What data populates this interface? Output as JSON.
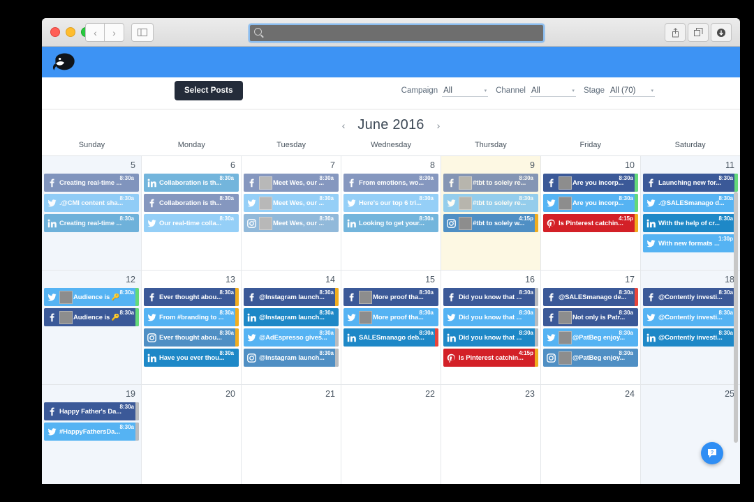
{
  "browser": {
    "search_placeholder": "",
    "search_value": "",
    "back_icon": "‹",
    "forward_icon": "›",
    "sidebar_icon": "sidebar",
    "share_icon": "share",
    "tabs_icon": "tabs",
    "downloads_icon": "downloads"
  },
  "appbar": {
    "logo_name": "whale-logo"
  },
  "toolbar": {
    "select_posts_label": "Select Posts",
    "filters": [
      {
        "label": "Campaign",
        "value": "All",
        "caret": "▾"
      },
      {
        "label": "Channel",
        "value": "All",
        "caret": "▾"
      },
      {
        "label": "Stage",
        "value": "All (70)",
        "caret": "▾"
      }
    ]
  },
  "calendar": {
    "month_title": "June 2016",
    "prev_arrow": "‹",
    "next_arrow": "›",
    "day_names": [
      "Sunday",
      "Monday",
      "Tuesday",
      "Wednesday",
      "Thursday",
      "Friday",
      "Saturday"
    ],
    "weeks": [
      {
        "days": [
          {
            "num": "5",
            "weekend": true,
            "today": false,
            "posts": [
              {
                "network": "facebook",
                "text": "Creating real-time ...",
                "time": "8:30a",
                "thumb": false,
                "stage": "",
                "dim": true
              },
              {
                "network": "twitter",
                "text": ".@CMI content sha...",
                "time": "8:30a",
                "thumb": false,
                "stage": "",
                "dim": true
              },
              {
                "network": "linkedin",
                "text": "Creating real-time ...",
                "time": "8:30a",
                "thumb": false,
                "stage": "",
                "dim": true
              }
            ]
          },
          {
            "num": "6",
            "weekend": false,
            "today": false,
            "posts": [
              {
                "network": "linkedin",
                "text": "Collaboration is th...",
                "time": "8:30a",
                "thumb": false,
                "stage": "",
                "dim": true
              },
              {
                "network": "facebook",
                "text": "Collaboration is th...",
                "time": "8:30a",
                "thumb": false,
                "stage": "",
                "dim": true
              },
              {
                "network": "twitter",
                "text": "Our real-time colla...",
                "time": "8:30a",
                "thumb": false,
                "stage": "",
                "dim": true
              }
            ]
          },
          {
            "num": "7",
            "weekend": false,
            "today": false,
            "posts": [
              {
                "network": "facebook",
                "text": "Meet Wes, our ...",
                "time": "8:30a",
                "thumb": true,
                "stage": "",
                "dim": true
              },
              {
                "network": "twitter",
                "text": "Meet Wes, our ...",
                "time": "8:30a",
                "thumb": true,
                "stage": "",
                "dim": true
              },
              {
                "network": "instagram",
                "text": "Meet Wes, our ...",
                "time": "8:30a",
                "thumb": true,
                "stage": "",
                "dim": true
              }
            ]
          },
          {
            "num": "8",
            "weekend": false,
            "today": false,
            "posts": [
              {
                "network": "facebook",
                "text": "From emotions, wo...",
                "time": "8:30a",
                "thumb": false,
                "stage": "",
                "dim": true
              },
              {
                "network": "twitter",
                "text": "Here's our top 6 tri...",
                "time": "8:30a",
                "thumb": false,
                "stage": "",
                "dim": true
              },
              {
                "network": "linkedin",
                "text": "Looking to get your...",
                "time": "8:30a",
                "thumb": false,
                "stage": "",
                "dim": true
              }
            ]
          },
          {
            "num": "9",
            "weekend": false,
            "today": true,
            "posts": [
              {
                "network": "facebook",
                "text": "#tbt to solely re...",
                "time": "8:30a",
                "thumb": true,
                "stage": "",
                "dim": true
              },
              {
                "network": "twitter",
                "text": "#tbt to solely re...",
                "time": "8:30a",
                "thumb": true,
                "stage": "",
                "dim": true
              },
              {
                "network": "instagram",
                "text": "#tbt to solely w...",
                "time": "4:15p",
                "thumb": true,
                "stage": "#f0ad1f",
                "dim": false
              }
            ]
          },
          {
            "num": "10",
            "weekend": false,
            "today": false,
            "posts": [
              {
                "network": "facebook",
                "text": "Are you incorp...",
                "time": "8:30a",
                "thumb": true,
                "stage": "#64d97a",
                "dim": false
              },
              {
                "network": "twitter",
                "text": "Are you incorp...",
                "time": "8:30a",
                "thumb": true,
                "stage": "#64d97a",
                "dim": false
              },
              {
                "network": "pinterest",
                "text": "Is Pinterest catchin...",
                "time": "4:15p",
                "thumb": false,
                "stage": "#f0ad1f",
                "dim": false
              }
            ]
          },
          {
            "num": "11",
            "weekend": true,
            "today": false,
            "posts": [
              {
                "network": "facebook",
                "text": "Launching new for...",
                "time": "8:30a",
                "thumb": false,
                "stage": "#64d97a",
                "dim": false
              },
              {
                "network": "twitter",
                "text": ".@SALESmanago d...",
                "time": "8:30a",
                "thumb": false,
                "stage": "#64d97a",
                "dim": false
              },
              {
                "network": "linkedin",
                "text": "With the help of cr...",
                "time": "8:30a",
                "thumb": false,
                "stage": "#f0ad1f",
                "dim": false
              },
              {
                "network": "twitter",
                "text": "With new formats ...",
                "time": "1:30p",
                "thumb": false,
                "stage": "#f0ad1f",
                "dim": false
              }
            ]
          }
        ]
      },
      {
        "days": [
          {
            "num": "12",
            "weekend": true,
            "today": false,
            "posts": [
              {
                "network": "twitter",
                "text": "Audience is 🔑",
                "time": "8:30a",
                "thumb": true,
                "stage": "#64d97a",
                "dim": false
              },
              {
                "network": "facebook",
                "text": "Audience is 🔑",
                "time": "8:30a",
                "thumb": true,
                "stage": "#64d97a",
                "dim": false
              }
            ]
          },
          {
            "num": "13",
            "weekend": false,
            "today": false,
            "posts": [
              {
                "network": "facebook",
                "text": "Ever thought abou...",
                "time": "8:30a",
                "thumb": false,
                "stage": "#f0ad1f",
                "dim": false
              },
              {
                "network": "twitter",
                "text": "From #branding to ...",
                "time": "8:30a",
                "thumb": false,
                "stage": "#f0ad1f",
                "dim": false
              },
              {
                "network": "instagram",
                "text": "Ever thought abou...",
                "time": "8:30a",
                "thumb": false,
                "stage": "#f0ad1f",
                "dim": false
              },
              {
                "network": "linkedin",
                "text": "Have you ever thou...",
                "time": "8:30a",
                "thumb": false,
                "stage": "",
                "dim": false
              }
            ]
          },
          {
            "num": "14",
            "weekend": false,
            "today": false,
            "posts": [
              {
                "network": "facebook",
                "text": "@Instagram launch...",
                "time": "8:30a",
                "thumb": false,
                "stage": "#f0ad1f",
                "dim": false
              },
              {
                "network": "linkedin",
                "text": "@Instagram launch...",
                "time": "8:30a",
                "thumb": false,
                "stage": "",
                "dim": false
              },
              {
                "network": "twitter",
                "text": "@AdEspresso gives...",
                "time": "8:30a",
                "thumb": false,
                "stage": "#b9bcc0",
                "dim": false
              },
              {
                "network": "instagram",
                "text": "@Instagram launch...",
                "time": "8:30a",
                "thumb": false,
                "stage": "#b9bcc0",
                "dim": false
              }
            ]
          },
          {
            "num": "15",
            "weekend": false,
            "today": false,
            "posts": [
              {
                "network": "facebook",
                "text": "More proof tha...",
                "time": "8:30a",
                "thumb": true,
                "stage": "",
                "dim": false
              },
              {
                "network": "twitter",
                "text": "More proof tha...",
                "time": "8:30a",
                "thumb": true,
                "stage": "",
                "dim": false
              },
              {
                "network": "linkedin",
                "text": "SALESmanago deb...",
                "time": "8:30a",
                "thumb": false,
                "stage": "#e8453c",
                "dim": false
              }
            ]
          },
          {
            "num": "16",
            "weekend": false,
            "today": false,
            "posts": [
              {
                "network": "facebook",
                "text": "Did you know that ...",
                "time": "8:30a",
                "thumb": false,
                "stage": "#b9bcc0",
                "dim": false
              },
              {
                "network": "twitter",
                "text": "Did you know that ...",
                "time": "8:30a",
                "thumb": false,
                "stage": "#b9bcc0",
                "dim": false
              },
              {
                "network": "linkedin",
                "text": "Did you know that ...",
                "time": "8:30a",
                "thumb": false,
                "stage": "#b9bcc0",
                "dim": false
              },
              {
                "network": "pinterest",
                "text": "Is Pinterest catchin...",
                "time": "4:15p",
                "thumb": false,
                "stage": "#f0ad1f",
                "dim": false
              }
            ]
          },
          {
            "num": "17",
            "weekend": false,
            "today": false,
            "posts": [
              {
                "network": "facebook",
                "text": "@SALESmanago de...",
                "time": "8:30a",
                "thumb": false,
                "stage": "#e8453c",
                "dim": false
              },
              {
                "network": "facebook",
                "text": "Not only is Patr...",
                "time": "8:30a",
                "thumb": true,
                "stage": "",
                "dim": false
              },
              {
                "network": "twitter",
                "text": "@PatBeg enjoy...",
                "time": "8:30a",
                "thumb": true,
                "stage": "",
                "dim": false
              },
              {
                "network": "instagram",
                "text": "@PatBeg enjoy...",
                "time": "8:30a",
                "thumb": true,
                "stage": "",
                "dim": false
              }
            ]
          },
          {
            "num": "18",
            "weekend": true,
            "today": false,
            "posts": [
              {
                "network": "facebook",
                "text": "@Contently investi...",
                "time": "8:30a",
                "thumb": false,
                "stage": "#b9bcc0",
                "dim": false
              },
              {
                "network": "twitter",
                "text": "@Contently investi...",
                "time": "8:30a",
                "thumb": false,
                "stage": "#b9bcc0",
                "dim": false
              },
              {
                "network": "linkedin",
                "text": "@Contently investi...",
                "time": "8:30a",
                "thumb": false,
                "stage": "#b9bcc0",
                "dim": false
              }
            ]
          }
        ]
      },
      {
        "days": [
          {
            "num": "19",
            "weekend": true,
            "today": false,
            "posts": [
              {
                "network": "facebook",
                "text": "Happy Father's Da...",
                "time": "8:30a",
                "thumb": false,
                "stage": "#b9bcc0",
                "dim": false
              },
              {
                "network": "twitter",
                "text": "#HappyFathersDa...",
                "time": "8:30a",
                "thumb": false,
                "stage": "#b9bcc0",
                "dim": false
              }
            ]
          },
          {
            "num": "20",
            "weekend": false,
            "today": false,
            "posts": []
          },
          {
            "num": "21",
            "weekend": false,
            "today": false,
            "posts": []
          },
          {
            "num": "22",
            "weekend": false,
            "today": false,
            "posts": []
          },
          {
            "num": "23",
            "weekend": false,
            "today": false,
            "posts": []
          },
          {
            "num": "24",
            "weekend": false,
            "today": false,
            "posts": []
          },
          {
            "num": "25",
            "weekend": true,
            "today": false,
            "posts": []
          }
        ]
      }
    ]
  },
  "help": {
    "icon": "chat-help-icon"
  },
  "colors": {
    "brand_blue": "#3d93f4",
    "facebook": "#3b5998",
    "twitter": "#55b3f3",
    "linkedin": "#1e88c7",
    "instagram": "#4f8fc4",
    "pinterest": "#d32027",
    "today_bg": "#fdf8e3",
    "weekend_bg": "#f2f6fb"
  }
}
